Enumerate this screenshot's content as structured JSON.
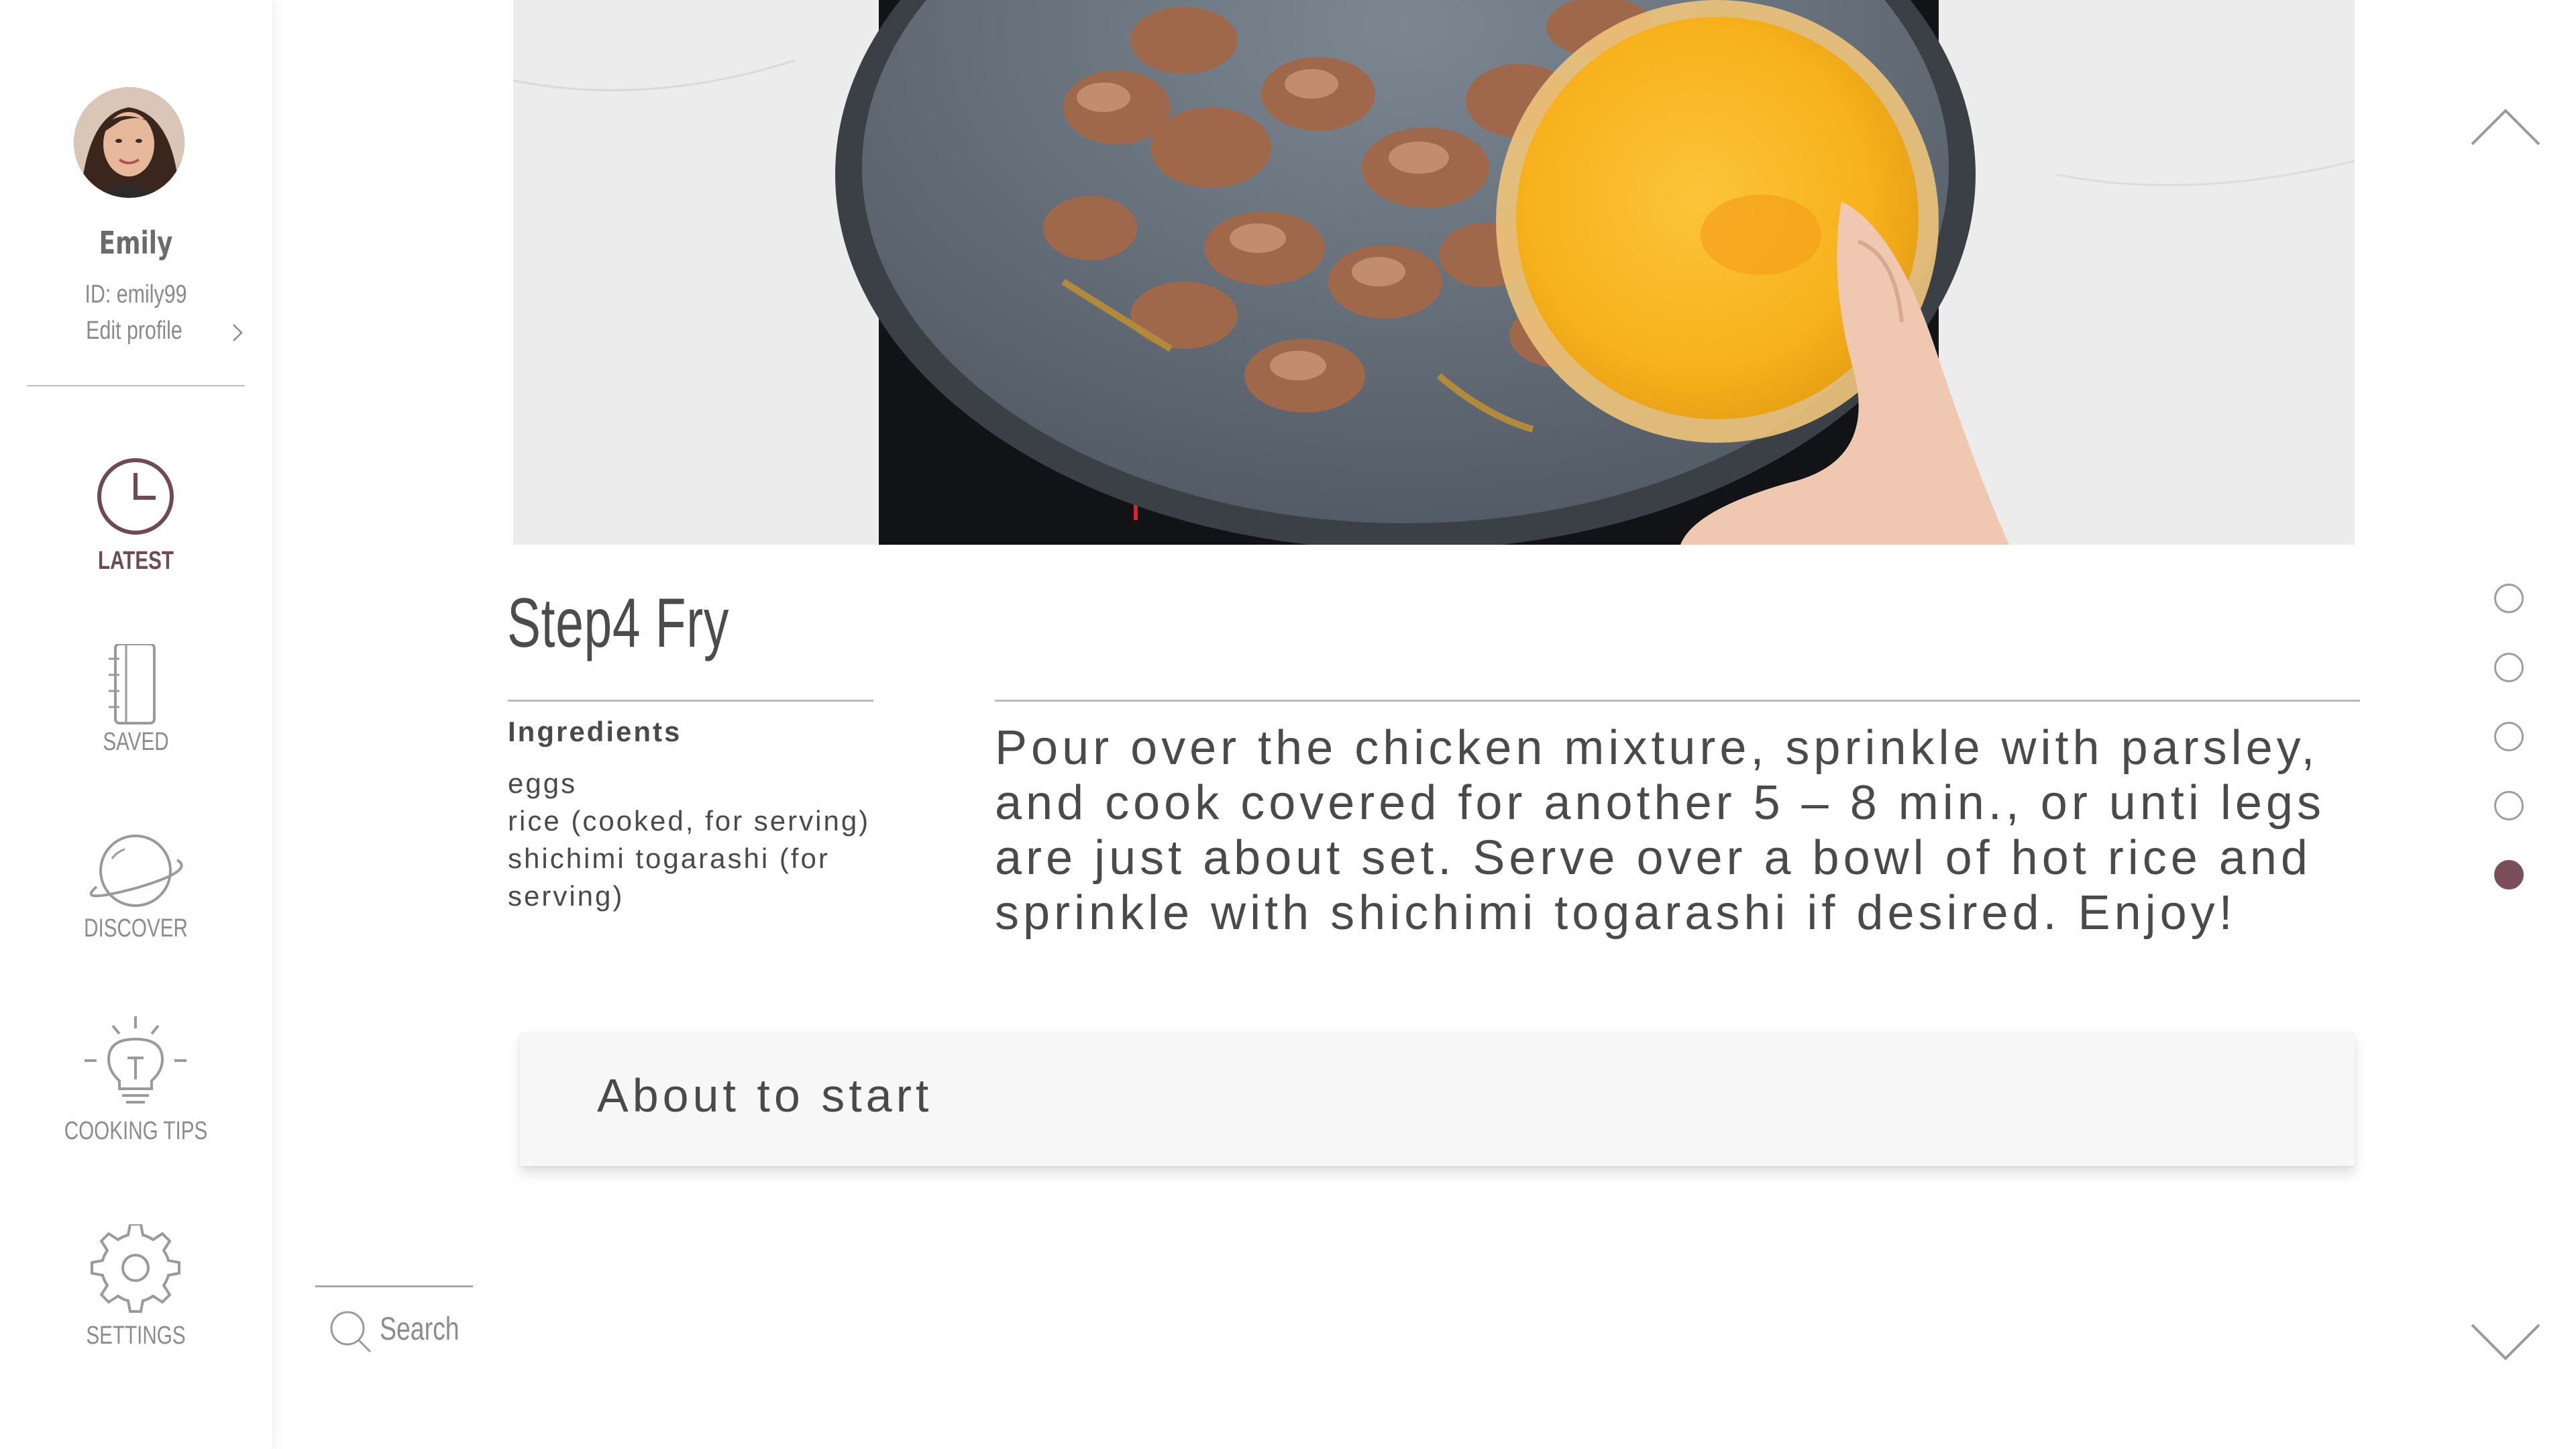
{
  "profile": {
    "name": "Emily",
    "id_text": "ID: emily99",
    "edit_label": "Edit profile"
  },
  "nav": {
    "latest": "LATEST",
    "saved": "SAVED",
    "discover": "DISCOVER",
    "cooking_tips": "COOKING TIPS",
    "settings": "SETTINGS",
    "active_item": "latest"
  },
  "search": {
    "placeholder": "Search"
  },
  "step": {
    "title": "Step4 Fry",
    "ingredients_heading": "Ingredients",
    "ingredients": [
      "eggs",
      "rice (cooked, for serving)",
      "shichimi togarashi (for",
      "serving)"
    ],
    "instruction": "Pour over the chicken mixture, sprinkle with parsley, and cook covered for another 5 – 8 min., or unti legs are just about set. Serve over a bowl of hot rice and sprinkle with shichimi togarashi if desired. Enjoy!"
  },
  "status": {
    "text": "About to start"
  },
  "pagination": {
    "total": 5,
    "current": 5
  },
  "colors": {
    "accent": "#7a4f5b",
    "text": "#4a4a4a",
    "muted": "#8c8c8c"
  }
}
